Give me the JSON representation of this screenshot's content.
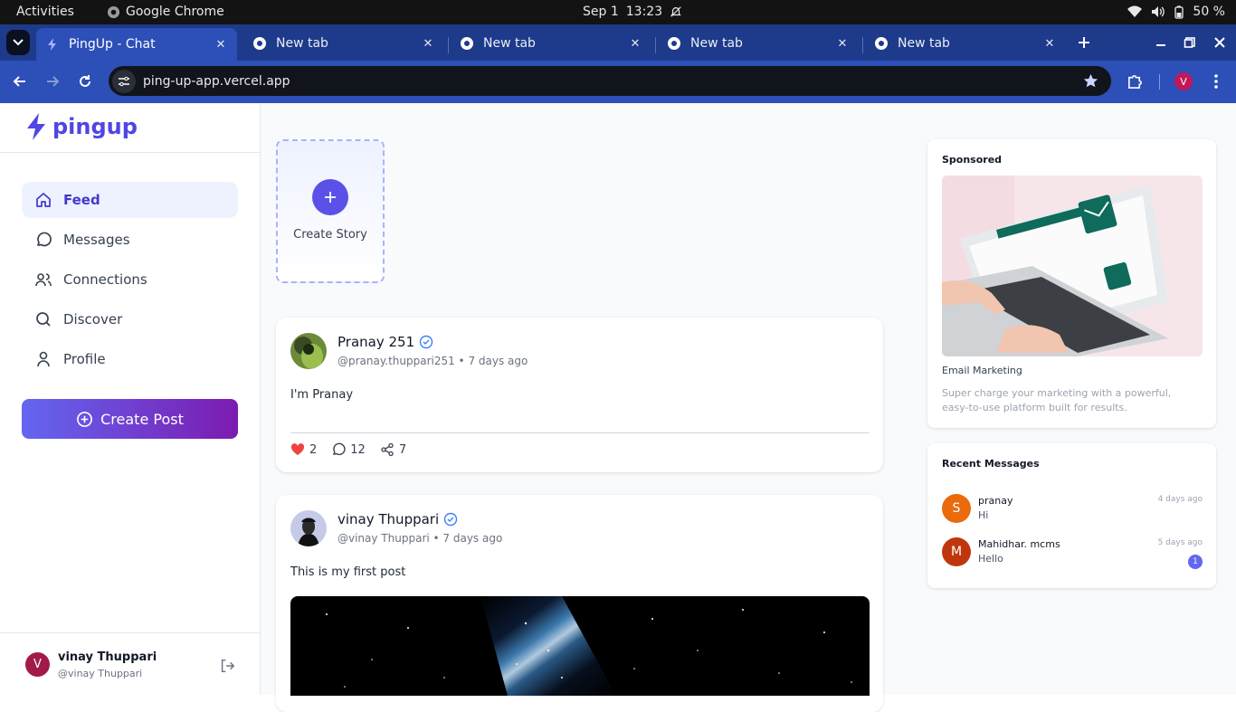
{
  "os": {
    "activities": "Activities",
    "app_name": "Google Chrome",
    "date": "Sep 1",
    "time": "13:23",
    "battery": "50 %"
  },
  "browser": {
    "tabs": [
      {
        "label": "PingUp - Chat",
        "active": true
      },
      {
        "label": "New tab",
        "active": false
      },
      {
        "label": "New tab",
        "active": false
      },
      {
        "label": "New tab",
        "active": false
      },
      {
        "label": "New tab",
        "active": false
      }
    ],
    "url": "ping-up-app.vercel.app",
    "profile_initial": "V"
  },
  "app": {
    "brand": "pingup",
    "nav": [
      {
        "label": "Feed",
        "active": true
      },
      {
        "label": "Messages"
      },
      {
        "label": "Connections"
      },
      {
        "label": "Discover"
      },
      {
        "label": "Profile"
      }
    ],
    "create_post": "Create Post",
    "current_user": {
      "initial": "V",
      "name": "vinay Thuppari",
      "handle": "@vinay Thuppari"
    },
    "stories": {
      "create_label": "Create Story"
    },
    "posts": [
      {
        "author": "Pranay 251",
        "meta": "@pranay.thuppari251 • 7 days ago",
        "text": "I'm Pranay",
        "likes": "2",
        "comments": "12",
        "shares": "7"
      },
      {
        "author": "vinay Thuppari",
        "meta": "@vinay Thuppari • 7 days ago",
        "text": "This is my first post"
      }
    ],
    "sponsored": {
      "title": "Sponsored",
      "name": "Email Marketing",
      "description": "Super charge your marketing with a powerful, easy-to-use platform built for results."
    },
    "recent_messages": {
      "title": "Recent Messages",
      "items": [
        {
          "initial": "S",
          "name": "pranay",
          "text": "Hi",
          "time": "4 days ago",
          "color": "#ea6a0c"
        },
        {
          "initial": "M",
          "name": "Mahidhar. mcms",
          "text": "Hello",
          "time": "5 days ago",
          "unread": "1",
          "color": "#bf360c"
        }
      ]
    }
  }
}
